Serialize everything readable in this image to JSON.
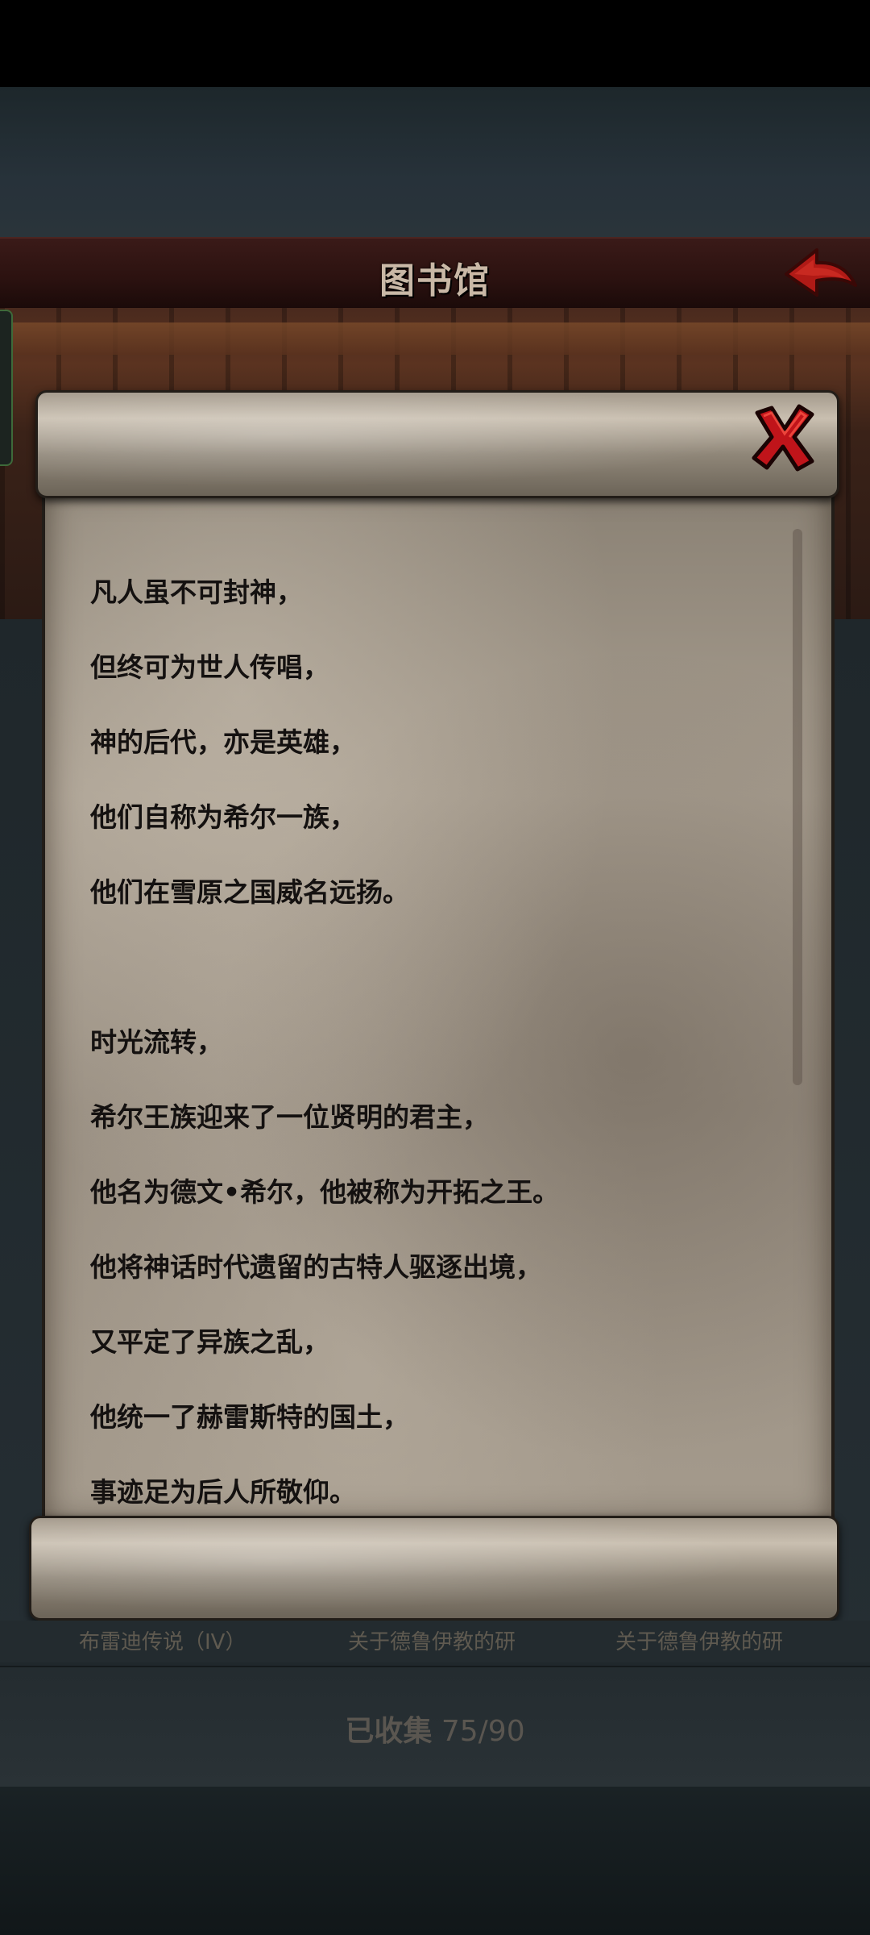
{
  "header": {
    "title": "图书馆",
    "back_icon": "back-arrow-icon"
  },
  "scroll": {
    "close_icon": "close-x-icon",
    "lines": [
      "凡人虽不可封神，",
      "但终可为世人传唱，",
      "神的后代，亦是英雄，",
      "他们自称为希尔一族，",
      "他们在雪原之国威名远扬。",
      "",
      "时光流转，",
      "希尔王族迎来了一位贤明的君主，",
      "他名为德文•希尔，他被称为开拓之王。",
      "他将神话时代遗留的古特人驱逐出境，",
      "又平定了异族之乱，",
      "他统一了赫雷斯特的国土，",
      "事迹足为后人所敬仰。"
    ]
  },
  "books": [
    "布雷迪传说（IV）",
    "关于德鲁伊教的研",
    "关于德鲁伊教的研"
  ],
  "collection": {
    "label": "已收集",
    "count": "75/90"
  },
  "colors": {
    "header_red": "#2c1210",
    "parchment": "#a49a8c",
    "close_red": "#c0141a",
    "text": "#141110"
  }
}
